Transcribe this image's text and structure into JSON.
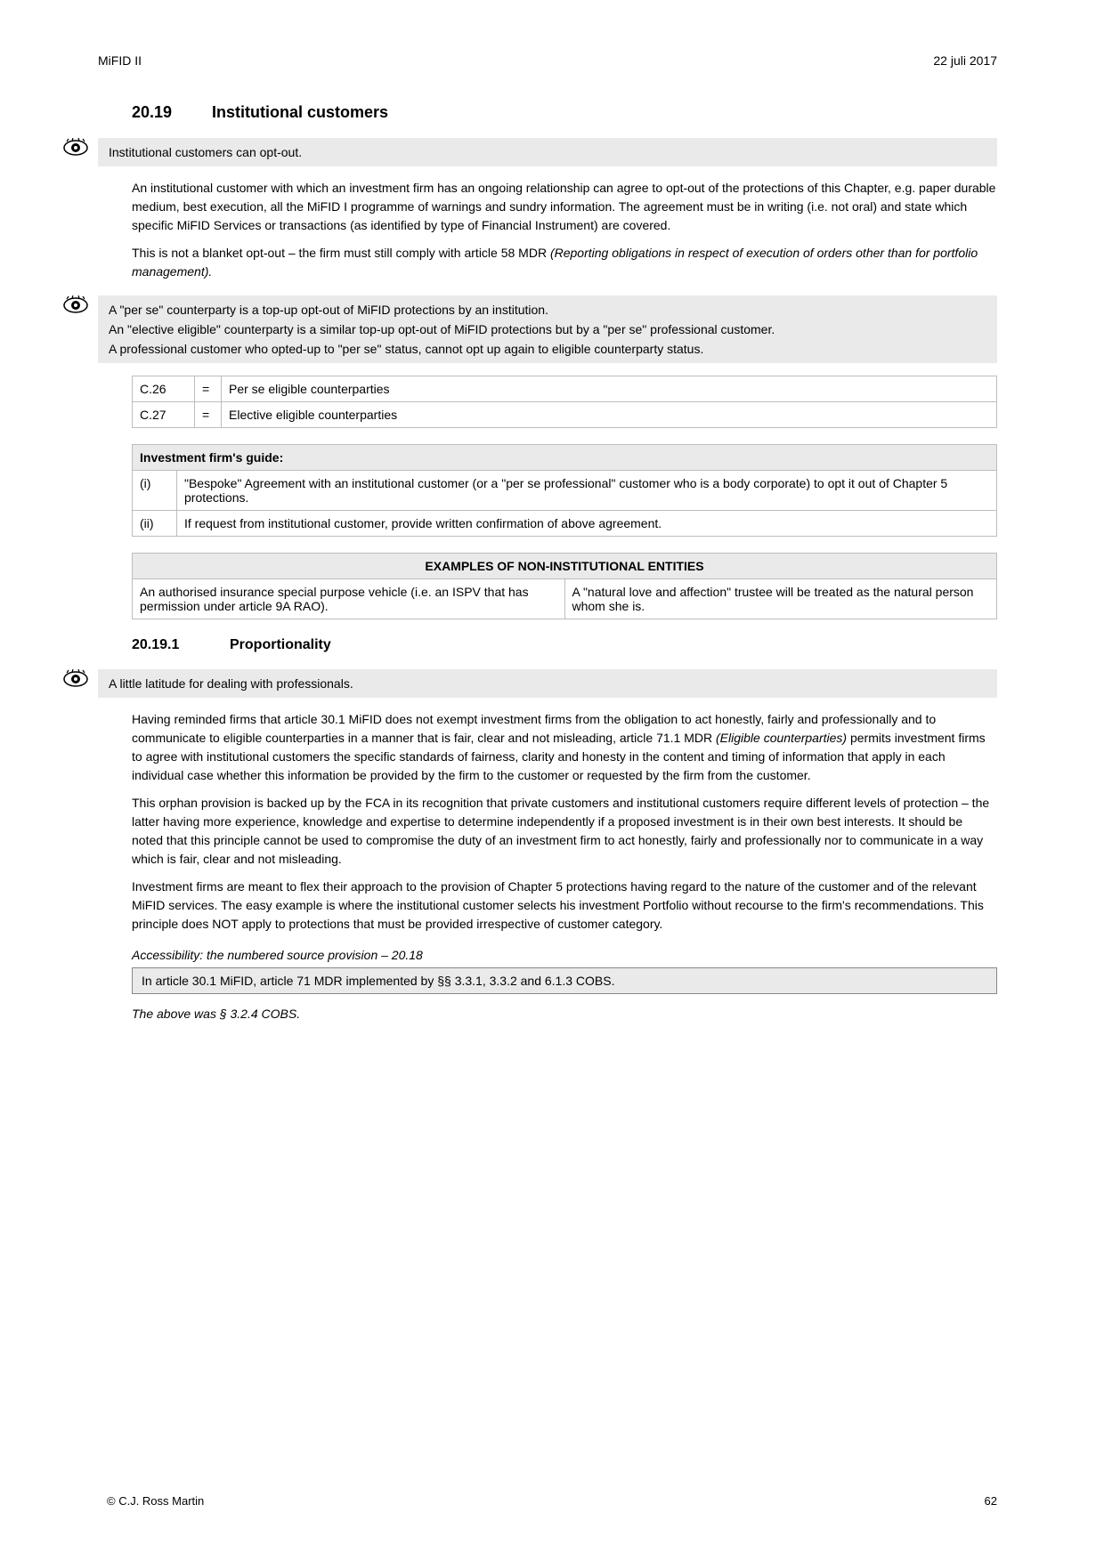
{
  "header": {
    "left": "MiFID II",
    "right": "22 juli 2017"
  },
  "section_number": "20.19",
  "section_title": "Institutional customers",
  "callout1": "Institutional customers can opt-out.",
  "para1": "An institutional customer with which an investment firm has an ongoing relationship can agree to opt-out of the protections of this Chapter, e.g. paper durable medium, best execution, all the MiFID I programme of warnings and sundry information. The agreement must be in writing (i.e. not oral) and state which specific MiFID Services or transactions (as identified by type of Financial Instrument) are covered.",
  "para2_prefix": "This is not a blanket opt-out – the firm must still comply with article 58 MDR ",
  "para2_italic": "(Reporting obligations in respect of execution of orders other than for portfolio management).",
  "callout2_lines": [
    "A \"per se\" counterparty is a top-up opt-out of MiFID protections by an institution.",
    "An \"elective eligible\" counterparty is a similar top-up opt-out of MiFID protections but by a \"per se\" professional customer.",
    "A professional customer who opted-up to \"per se\" status, cannot opt up again to eligible counterparty status."
  ],
  "defs_table": [
    {
      "id": "C.26",
      "sep": "=",
      "text": "Per se eligible counterparties"
    },
    {
      "id": "C.27",
      "sep": "=",
      "text": "Elective eligible counterparties"
    }
  ],
  "guide_header": "Investment firm's guide:",
  "guide_rows": [
    {
      "id": "(i)",
      "text": "\"Bespoke\" Agreement with an institutional customer (or a \"per se professional\" customer who is a body corporate) to opt it out of Chapter 5 protections."
    },
    {
      "id": "(ii)",
      "text": "If request from institutional customer, provide written confirmation of above agreement."
    }
  ],
  "example_header": "EXAMPLES OF NON-INSTITUTIONAL ENTITIES",
  "example_rows": [
    {
      "left": "An authorised insurance special purpose vehicle (i.e. an ISPV that has permission under article 9A RAO).",
      "right": "A \"natural love and affection\" trustee will be treated as the natural person whom she is."
    }
  ],
  "sub_section_number": "20.19.1",
  "sub_section_title": "Proportionality",
  "sub_callout": "A little latitude for dealing with professionals.",
  "para3_prefix": "Having reminded firms that article 30.1 MiFID does not exempt investment firms from the obligation to act honestly, fairly and professionally and to communicate to eligible counterparties in a manner that is fair, clear and not misleading, article 71.1 MDR ",
  "para3_italic": "(Eligible counterparties)",
  "para3_suffix": " permits investment firms to agree with institutional customers the specific standards of fairness, clarity and honesty in the content and timing of information that apply in each individual case whether this information be provided by the firm to the customer or requested by the firm from the customer.",
  "para4": "This orphan provision is backed up by the FCA in its recognition that private customers and institutional customers require different levels of protection – the latter having more experience, knowledge and expertise to determine independently if a proposed investment is in their own best interests. It should be noted that this principle cannot be used to compromise the duty of an investment firm to act honestly, fairly and professionally nor to communicate in a way which is fair, clear and not misleading.",
  "para5": "Investment firms are meant to flex their approach to the provision of Chapter 5 protections having regard to the nature of the customer and of the relevant MiFID services. The easy example is where the institutional customer selects his investment Portfolio without recourse to the firm's recommendations. This principle does NOT apply to protections that must be provided irrespective of customer category.",
  "accessibility_title": "Accessibility: the numbered source provision – 20.18",
  "accessibility_text": "In article 30.1 MiFID, article 71 MDR implemented by §§ 3.3.1, 3.3.2 and 6.1.3 COBS.",
  "italic_line": "The above was § 3.2.4 COBS.",
  "footer": {
    "left": "© C.J. Ross Martin",
    "right": "62"
  }
}
